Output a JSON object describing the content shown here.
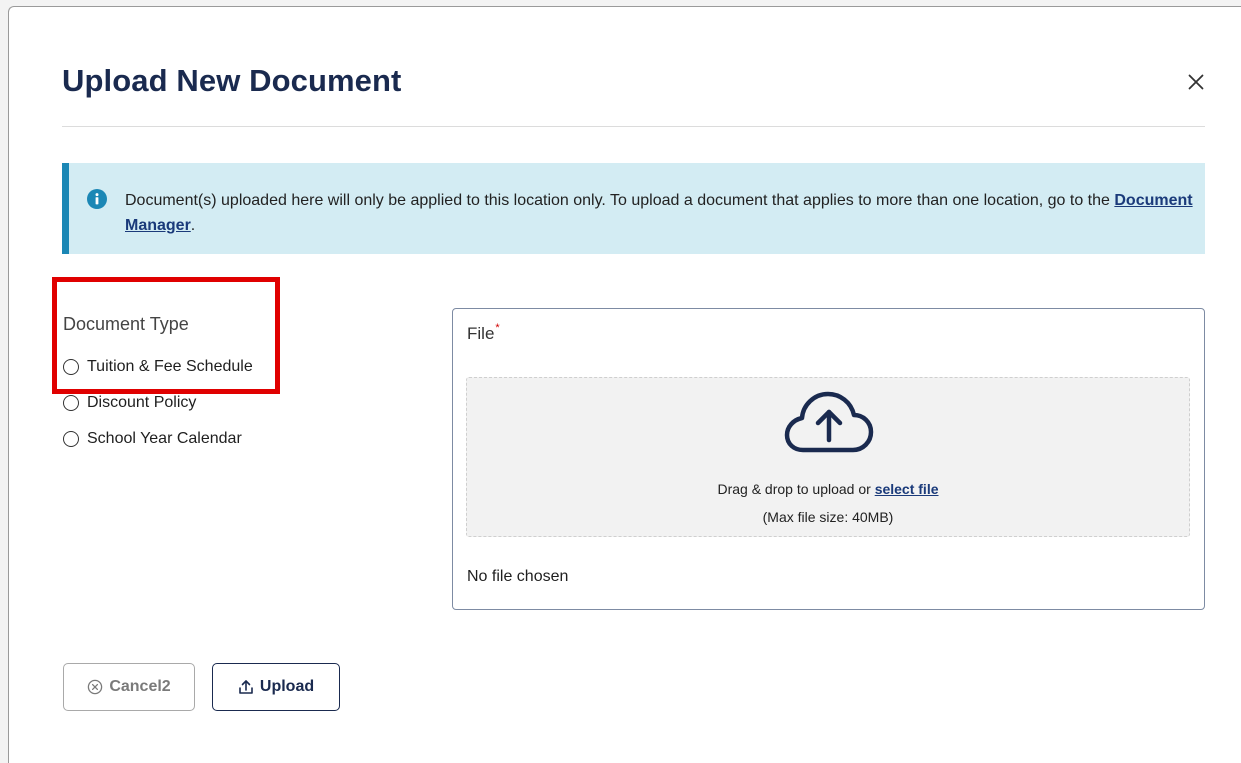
{
  "modal": {
    "title": "Upload New Document",
    "close_icon": "close-icon"
  },
  "info_banner": {
    "icon": "info-circle-icon",
    "text_before": "Document(s) uploaded here will only be applied to this location only. To upload a document that applies to more than one location, go to the ",
    "link_text": "Document Manager",
    "text_after": "."
  },
  "document_type": {
    "label": "Document Type",
    "options": [
      {
        "label": "Tuition & Fee Schedule",
        "selected": false
      },
      {
        "label": "Discount Policy",
        "selected": false
      },
      {
        "label": "School Year Calendar",
        "selected": false
      }
    ]
  },
  "file_upload": {
    "label": "File",
    "required_mark": "*",
    "icon": "cloud-upload-icon",
    "drop_text": "Drag & drop to upload or ",
    "select_link": "select file",
    "max_size": "(Max file size: 40MB)",
    "status": "No file chosen"
  },
  "actions": {
    "cancel_label": "Cancel2",
    "cancel_icon": "circle-x-icon",
    "upload_label": "Upload",
    "upload_icon": "upload-tray-icon"
  },
  "colors": {
    "title": "#1a2a4f",
    "banner_bg": "#d3ecf3",
    "banner_accent": "#1b87b5",
    "link": "#1a3a7a",
    "highlight": "#e00000",
    "required": "#d00000"
  }
}
